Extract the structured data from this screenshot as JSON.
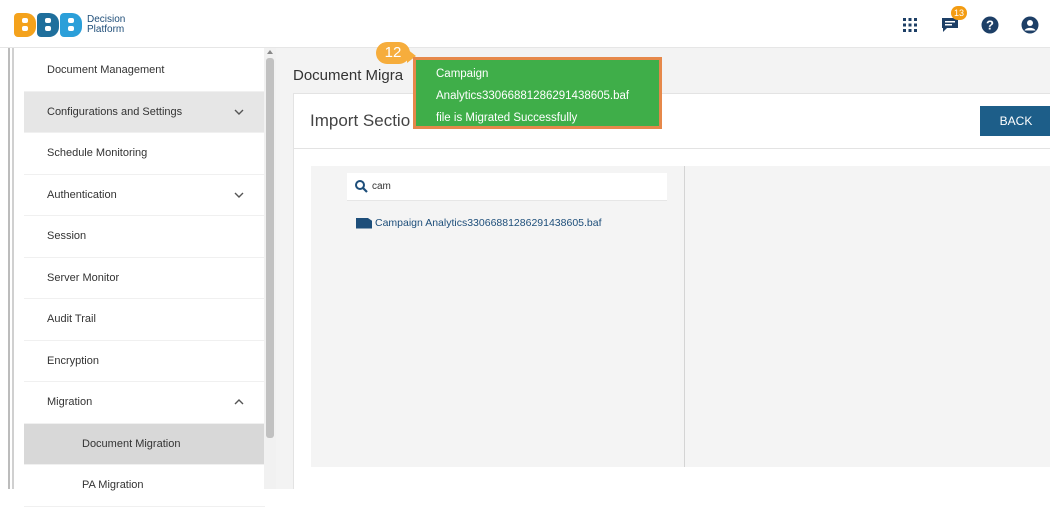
{
  "app": {
    "logo_text_line1": "Decision",
    "logo_text_line2": "Platform",
    "notification_count": "13"
  },
  "sidebar": {
    "items": [
      {
        "label": "Document Management"
      },
      {
        "label": "Configurations and Settings"
      },
      {
        "label": "Schedule Monitoring"
      },
      {
        "label": "Authentication"
      },
      {
        "label": "Session"
      },
      {
        "label": "Server Monitor"
      },
      {
        "label": "Audit Trail"
      },
      {
        "label": "Encryption"
      },
      {
        "label": "Migration"
      }
    ],
    "sub_items": [
      {
        "label": "Document Migration"
      },
      {
        "label": "PA Migration"
      }
    ]
  },
  "main": {
    "page_title": "Document Migra",
    "section_title": "Import Sectio",
    "back_label": "BACK",
    "search_value": "cam",
    "file_name": "Campaign Analytics33066881286291438605.baf"
  },
  "toast": {
    "step": "12",
    "line1": "Campaign",
    "line2": "Analytics33066881286291438605.baf",
    "line3": "file is Migrated Successfully"
  },
  "colors": {
    "accent": "#1d5e89",
    "toast_bg": "#3fae49",
    "toast_border": "#e6884a",
    "badge": "#f39c12"
  }
}
